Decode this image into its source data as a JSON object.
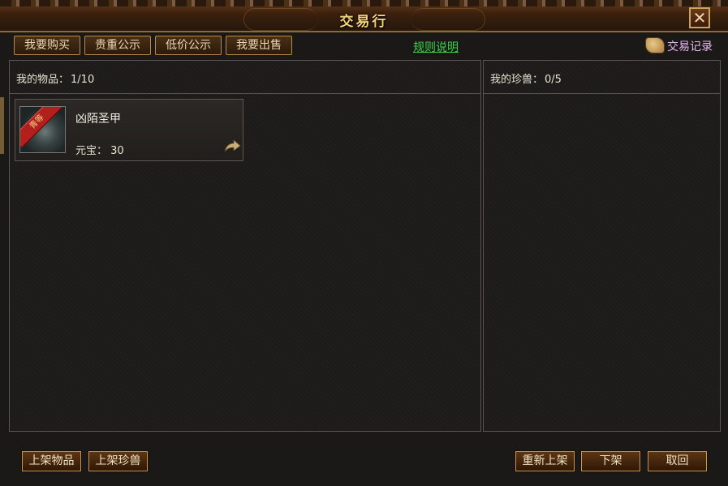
{
  "window": {
    "title": "交易行",
    "close_glyph": "✕"
  },
  "tabs": [
    {
      "label": "我要购买"
    },
    {
      "label": "贵重公示"
    },
    {
      "label": "低价公示"
    },
    {
      "label": "我要出售"
    }
  ],
  "rules_link": "规则说明",
  "trade_record": {
    "label": "交易记录",
    "icon": "scroll-icon"
  },
  "left_panel": {
    "header_label": "我的物品：",
    "count": "1/10",
    "items": [
      {
        "name": "凶陌圣甲",
        "price": "元宝：  30",
        "badge": "青等",
        "action_icon": "share-arrow-icon"
      }
    ]
  },
  "right_panel": {
    "header_label": "我的珍兽：",
    "count": "0/5"
  },
  "bottom_buttons": {
    "list_item": "上架物品",
    "list_beast": "上架珍兽",
    "relist": "重新上架",
    "delist": "下架",
    "cancel": "取回"
  },
  "colors": {
    "title_gold": "#f4d279",
    "link_green": "#3dd24a",
    "record_pink": "#e7b8f0",
    "button_border": "#c79850"
  }
}
